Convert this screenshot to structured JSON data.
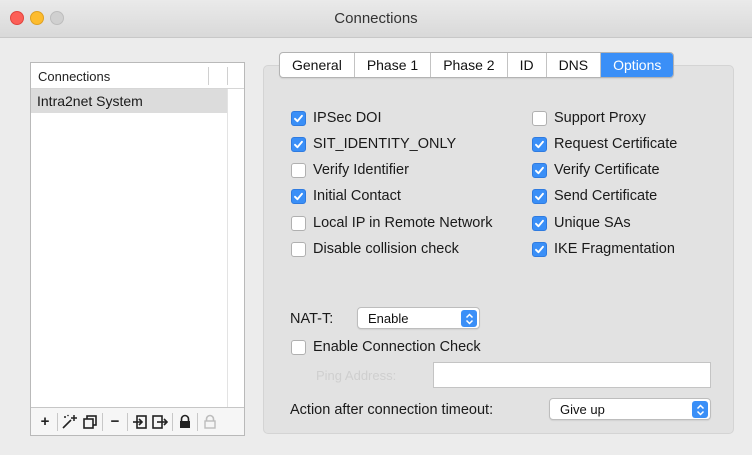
{
  "window": {
    "title": "Connections"
  },
  "sidebar": {
    "header": "Connections",
    "items": [
      {
        "label": "Intra2net System",
        "selected": true
      }
    ],
    "toolbar": [
      {
        "name": "add",
        "symbol": "+",
        "enabled": true
      },
      {
        "name": "wizard",
        "symbol": "⋰",
        "enabled": true
      },
      {
        "name": "duplicate",
        "symbol": "❐",
        "enabled": true
      },
      {
        "name": "remove",
        "symbol": "−",
        "enabled": true
      },
      {
        "name": "import",
        "symbol": "⇥",
        "enabled": true
      },
      {
        "name": "export",
        "symbol": "↦",
        "enabled": true
      },
      {
        "name": "lock",
        "symbol": "🔒",
        "enabled": true
      },
      {
        "name": "unlock",
        "symbol": "🔓",
        "enabled": false
      }
    ]
  },
  "tabs": [
    {
      "label": "General",
      "active": false
    },
    {
      "label": "Phase 1",
      "active": false
    },
    {
      "label": "Phase 2",
      "active": false
    },
    {
      "label": "ID",
      "active": false
    },
    {
      "label": "DNS",
      "active": false
    },
    {
      "label": "Options",
      "active": true
    }
  ],
  "options": {
    "left": [
      {
        "label": "IPSec DOI",
        "checked": true
      },
      {
        "label": "SIT_IDENTITY_ONLY",
        "checked": true
      },
      {
        "label": "Verify Identifier",
        "checked": false
      },
      {
        "label": "Initial Contact",
        "checked": true
      },
      {
        "label": "Local IP in Remote Network",
        "checked": false
      },
      {
        "label": "Disable collision check",
        "checked": false
      }
    ],
    "right": [
      {
        "label": "Support Proxy",
        "checked": false
      },
      {
        "label": "Request Certificate",
        "checked": true
      },
      {
        "label": "Verify Certificate",
        "checked": true
      },
      {
        "label": "Send Certificate",
        "checked": true
      },
      {
        "label": "Unique SAs",
        "checked": true
      },
      {
        "label": "IKE Fragmentation",
        "checked": true
      }
    ]
  },
  "nat": {
    "label": "NAT-T:",
    "value": "Enable"
  },
  "connection_check": {
    "label": "Enable Connection Check",
    "checked": false
  },
  "ping": {
    "label": "Ping Address:",
    "value": ""
  },
  "timeout": {
    "label": "Action after connection timeout:",
    "value": "Give up"
  },
  "colors": {
    "accent": "#3a8ff7",
    "background": "#ececec",
    "panel": "#e2e2e2"
  }
}
